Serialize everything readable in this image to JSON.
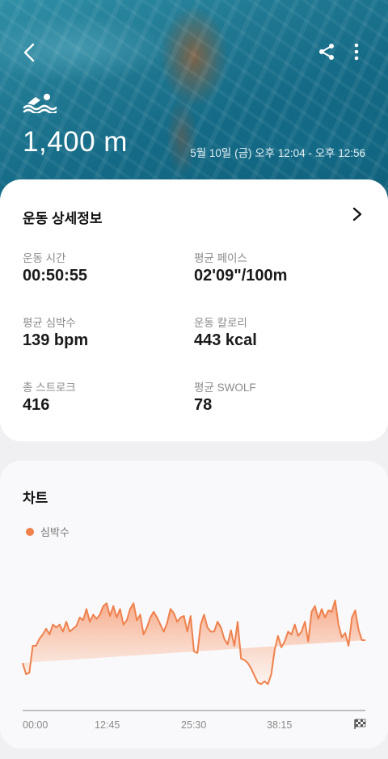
{
  "hero": {
    "distance": "1,400 m",
    "datetime": "5월 10일 (금) 오후 12:04 - 오후 12:56",
    "icons": [
      "back-icon",
      "share-icon",
      "more-options-icon",
      "swimming-icon"
    ]
  },
  "detail": {
    "title": "운동 상세정보",
    "stats": [
      {
        "label": "운동 시간",
        "value": "00:50:55"
      },
      {
        "label": "평균 페이스",
        "value": "02'09\"/100m"
      },
      {
        "label": "평균 심박수",
        "value": "139 bpm"
      },
      {
        "label": "운동 칼로리",
        "value": "443 kcal"
      },
      {
        "label": "총 스트로크",
        "value": "416"
      },
      {
        "label": "평균 SWOLF",
        "value": "78"
      }
    ]
  },
  "chart_section": {
    "title": "차트",
    "legend": "심박수"
  },
  "colors": {
    "accent": "#f0814c",
    "fill_top": "#f6a07a",
    "fill_bottom": "#fdeee6"
  },
  "chart_data": {
    "type": "area",
    "x_tick_labels": [
      "00:00",
      "12:45",
      "25:30",
      "38:15"
    ],
    "end_marker": "finish-flag-icon",
    "x_unit": "elapsed minutes",
    "x": [
      0,
      0.5,
      1,
      1.5,
      2,
      2.5,
      3,
      3.5,
      4,
      4.5,
      5,
      5.5,
      6,
      6.5,
      7,
      7.5,
      8,
      8.5,
      9,
      9.5,
      10,
      10.5,
      11,
      11.5,
      12,
      12.5,
      13,
      13.5,
      14,
      14.5,
      15,
      15.5,
      16,
      16.5,
      17,
      17.5,
      18,
      18.5,
      19,
      19.5,
      20,
      20.5,
      21,
      21.5,
      22,
      22.5,
      23,
      23.5,
      24,
      24.5,
      25,
      25.5,
      26,
      26.5,
      27,
      27.5,
      28,
      28.5,
      29,
      29.5,
      30,
      30.5,
      31,
      31.5,
      32,
      32.5,
      33,
      33.5,
      34,
      34.5,
      35,
      35.5,
      36,
      36.5,
      37,
      37.5,
      38,
      38.5,
      39,
      39.5,
      40,
      40.5,
      41,
      41.5,
      42,
      42.5,
      43,
      43.5,
      44,
      44.5,
      45,
      45.5,
      46,
      46.5,
      47,
      47.5,
      48,
      48.5,
      49,
      49.5,
      50,
      50.5,
      51
    ],
    "values": [
      128,
      120,
      121,
      140,
      140,
      145,
      148,
      152,
      148,
      155,
      153,
      155,
      150,
      157,
      150,
      152,
      154,
      160,
      158,
      166,
      157,
      162,
      159,
      162,
      168,
      170,
      161,
      168,
      160,
      166,
      155,
      158,
      166,
      170,
      158,
      162,
      148,
      153,
      160,
      164,
      160,
      155,
      150,
      156,
      166,
      163,
      157,
      160,
      161,
      150,
      161,
      136,
      135,
      155,
      162,
      153,
      150,
      150,
      157,
      153,
      145,
      141,
      151,
      140,
      157,
      131,
      130,
      128,
      124,
      119,
      114,
      113,
      115,
      113,
      120,
      137,
      147,
      139,
      143,
      150,
      148,
      155,
      147,
      150,
      157,
      143,
      164,
      168,
      159,
      166,
      160,
      165,
      164,
      172,
      155,
      146,
      149,
      140,
      160,
      165,
      151,
      144,
      144,
      156
    ],
    "ylim": [
      95,
      185
    ],
    "grid": false
  }
}
